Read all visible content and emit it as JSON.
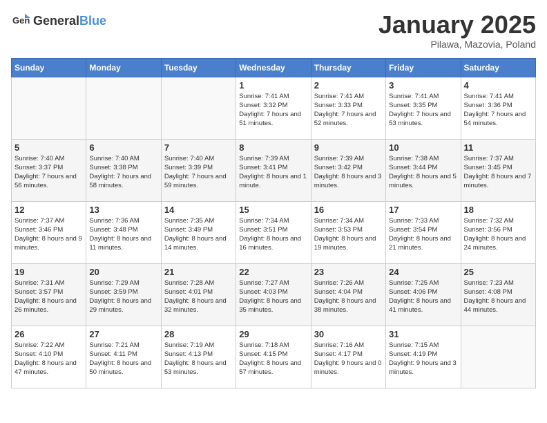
{
  "header": {
    "logo_general": "General",
    "logo_blue": "Blue",
    "title": "January 2025",
    "subtitle": "Pilawa, Mazovia, Poland"
  },
  "weekdays": [
    "Sunday",
    "Monday",
    "Tuesday",
    "Wednesday",
    "Thursday",
    "Friday",
    "Saturday"
  ],
  "weeks": [
    [
      {
        "day": "",
        "sunrise": "",
        "sunset": "",
        "daylight": ""
      },
      {
        "day": "",
        "sunrise": "",
        "sunset": "",
        "daylight": ""
      },
      {
        "day": "",
        "sunrise": "",
        "sunset": "",
        "daylight": ""
      },
      {
        "day": "1",
        "sunrise": "Sunrise: 7:41 AM",
        "sunset": "Sunset: 3:32 PM",
        "daylight": "Daylight: 7 hours and 51 minutes."
      },
      {
        "day": "2",
        "sunrise": "Sunrise: 7:41 AM",
        "sunset": "Sunset: 3:33 PM",
        "daylight": "Daylight: 7 hours and 52 minutes."
      },
      {
        "day": "3",
        "sunrise": "Sunrise: 7:41 AM",
        "sunset": "Sunset: 3:35 PM",
        "daylight": "Daylight: 7 hours and 53 minutes."
      },
      {
        "day": "4",
        "sunrise": "Sunrise: 7:41 AM",
        "sunset": "Sunset: 3:36 PM",
        "daylight": "Daylight: 7 hours and 54 minutes."
      }
    ],
    [
      {
        "day": "5",
        "sunrise": "Sunrise: 7:40 AM",
        "sunset": "Sunset: 3:37 PM",
        "daylight": "Daylight: 7 hours and 56 minutes."
      },
      {
        "day": "6",
        "sunrise": "Sunrise: 7:40 AM",
        "sunset": "Sunset: 3:38 PM",
        "daylight": "Daylight: 7 hours and 58 minutes."
      },
      {
        "day": "7",
        "sunrise": "Sunrise: 7:40 AM",
        "sunset": "Sunset: 3:39 PM",
        "daylight": "Daylight: 7 hours and 59 minutes."
      },
      {
        "day": "8",
        "sunrise": "Sunrise: 7:39 AM",
        "sunset": "Sunset: 3:41 PM",
        "daylight": "Daylight: 8 hours and 1 minute."
      },
      {
        "day": "9",
        "sunrise": "Sunrise: 7:39 AM",
        "sunset": "Sunset: 3:42 PM",
        "daylight": "Daylight: 8 hours and 3 minutes."
      },
      {
        "day": "10",
        "sunrise": "Sunrise: 7:38 AM",
        "sunset": "Sunset: 3:44 PM",
        "daylight": "Daylight: 8 hours and 5 minutes."
      },
      {
        "day": "11",
        "sunrise": "Sunrise: 7:37 AM",
        "sunset": "Sunset: 3:45 PM",
        "daylight": "Daylight: 8 hours and 7 minutes."
      }
    ],
    [
      {
        "day": "12",
        "sunrise": "Sunrise: 7:37 AM",
        "sunset": "Sunset: 3:46 PM",
        "daylight": "Daylight: 8 hours and 9 minutes."
      },
      {
        "day": "13",
        "sunrise": "Sunrise: 7:36 AM",
        "sunset": "Sunset: 3:48 PM",
        "daylight": "Daylight: 8 hours and 11 minutes."
      },
      {
        "day": "14",
        "sunrise": "Sunrise: 7:35 AM",
        "sunset": "Sunset: 3:49 PM",
        "daylight": "Daylight: 8 hours and 14 minutes."
      },
      {
        "day": "15",
        "sunrise": "Sunrise: 7:34 AM",
        "sunset": "Sunset: 3:51 PM",
        "daylight": "Daylight: 8 hours and 16 minutes."
      },
      {
        "day": "16",
        "sunrise": "Sunrise: 7:34 AM",
        "sunset": "Sunset: 3:53 PM",
        "daylight": "Daylight: 8 hours and 19 minutes."
      },
      {
        "day": "17",
        "sunrise": "Sunrise: 7:33 AM",
        "sunset": "Sunset: 3:54 PM",
        "daylight": "Daylight: 8 hours and 21 minutes."
      },
      {
        "day": "18",
        "sunrise": "Sunrise: 7:32 AM",
        "sunset": "Sunset: 3:56 PM",
        "daylight": "Daylight: 8 hours and 24 minutes."
      }
    ],
    [
      {
        "day": "19",
        "sunrise": "Sunrise: 7:31 AM",
        "sunset": "Sunset: 3:57 PM",
        "daylight": "Daylight: 8 hours and 26 minutes."
      },
      {
        "day": "20",
        "sunrise": "Sunrise: 7:29 AM",
        "sunset": "Sunset: 3:59 PM",
        "daylight": "Daylight: 8 hours and 29 minutes."
      },
      {
        "day": "21",
        "sunrise": "Sunrise: 7:28 AM",
        "sunset": "Sunset: 4:01 PM",
        "daylight": "Daylight: 8 hours and 32 minutes."
      },
      {
        "day": "22",
        "sunrise": "Sunrise: 7:27 AM",
        "sunset": "Sunset: 4:03 PM",
        "daylight": "Daylight: 8 hours and 35 minutes."
      },
      {
        "day": "23",
        "sunrise": "Sunrise: 7:26 AM",
        "sunset": "Sunset: 4:04 PM",
        "daylight": "Daylight: 8 hours and 38 minutes."
      },
      {
        "day": "24",
        "sunrise": "Sunrise: 7:25 AM",
        "sunset": "Sunset: 4:06 PM",
        "daylight": "Daylight: 8 hours and 41 minutes."
      },
      {
        "day": "25",
        "sunrise": "Sunrise: 7:23 AM",
        "sunset": "Sunset: 4:08 PM",
        "daylight": "Daylight: 8 hours and 44 minutes."
      }
    ],
    [
      {
        "day": "26",
        "sunrise": "Sunrise: 7:22 AM",
        "sunset": "Sunset: 4:10 PM",
        "daylight": "Daylight: 8 hours and 47 minutes."
      },
      {
        "day": "27",
        "sunrise": "Sunrise: 7:21 AM",
        "sunset": "Sunset: 4:11 PM",
        "daylight": "Daylight: 8 hours and 50 minutes."
      },
      {
        "day": "28",
        "sunrise": "Sunrise: 7:19 AM",
        "sunset": "Sunset: 4:13 PM",
        "daylight": "Daylight: 8 hours and 53 minutes."
      },
      {
        "day": "29",
        "sunrise": "Sunrise: 7:18 AM",
        "sunset": "Sunset: 4:15 PM",
        "daylight": "Daylight: 8 hours and 57 minutes."
      },
      {
        "day": "30",
        "sunrise": "Sunrise: 7:16 AM",
        "sunset": "Sunset: 4:17 PM",
        "daylight": "Daylight: 9 hours and 0 minutes."
      },
      {
        "day": "31",
        "sunrise": "Sunrise: 7:15 AM",
        "sunset": "Sunset: 4:19 PM",
        "daylight": "Daylight: 9 hours and 3 minutes."
      },
      {
        "day": "",
        "sunrise": "",
        "sunset": "",
        "daylight": ""
      }
    ]
  ]
}
